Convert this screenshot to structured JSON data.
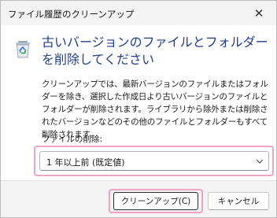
{
  "window": {
    "title": "ファイル履歴のクリーンアップ",
    "close_symbol": "✕"
  },
  "main": {
    "icon": "recycle-bin-icon",
    "heading": "古いバージョンのファイルとフォルダーを削除してください",
    "description": "クリーンアップでは、最新バージョンのファイルまたはフォルダーを除き、選択した作成日より古いバージョンのファイルとフォルダーが削除されます。ライブラリから除外または削除されたバージョンなどのその他のファイルとフォルダーもすべて削除されます。",
    "dropdown_label": "ファイルの削除:",
    "dropdown_value": "1 年以上前 (既定値)"
  },
  "footer": {
    "cleanup_label": "クリーンアップ(C)",
    "cancel_label": "キャンセル"
  },
  "colors": {
    "heading": "#1f3d8a",
    "highlight": "#f0a3c4",
    "recycle_green": "#2a9d3f",
    "recycle_blue": "#3a7bd5"
  }
}
